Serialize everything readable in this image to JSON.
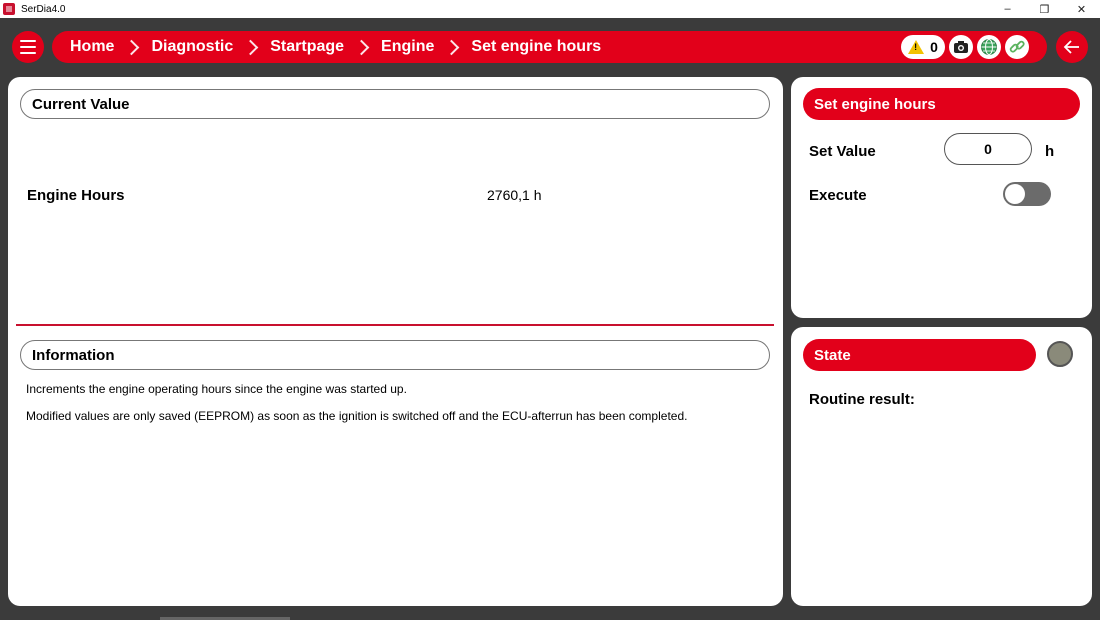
{
  "window": {
    "title": "SerDia4.0",
    "controls": {
      "minimize": "–",
      "restore": "❐",
      "close": "✕"
    }
  },
  "breadcrumb": [
    "Home",
    "Diagnostic",
    "Startpage",
    "Engine",
    "Set engine hours"
  ],
  "header": {
    "warning_count": "0",
    "icons": [
      "menu-icon",
      "warning-icon",
      "camera-icon",
      "globe-icon",
      "link-icon",
      "back-arrow-icon"
    ]
  },
  "current_value": {
    "title": "Current Value",
    "rows": [
      {
        "label": "Engine Hours",
        "value": "2760,1 h"
      }
    ]
  },
  "information": {
    "title": "Information",
    "lines": [
      "Increments the engine operating hours since the engine was started up.",
      "Modified values are only saved (EEPROM) as soon as the ignition is switched off and the ECU-afterrun has been completed."
    ]
  },
  "set_engine_hours": {
    "title": "Set engine hours",
    "set_value_label": "Set Value",
    "set_value": "0",
    "unit": "h",
    "execute_label": "Execute",
    "execute_on": false
  },
  "state": {
    "title": "State",
    "routine_result_label": "Routine result:"
  },
  "colors": {
    "brand_red": "#e2001a",
    "background": "#3b3b3b",
    "divider_red": "#c8102e"
  }
}
